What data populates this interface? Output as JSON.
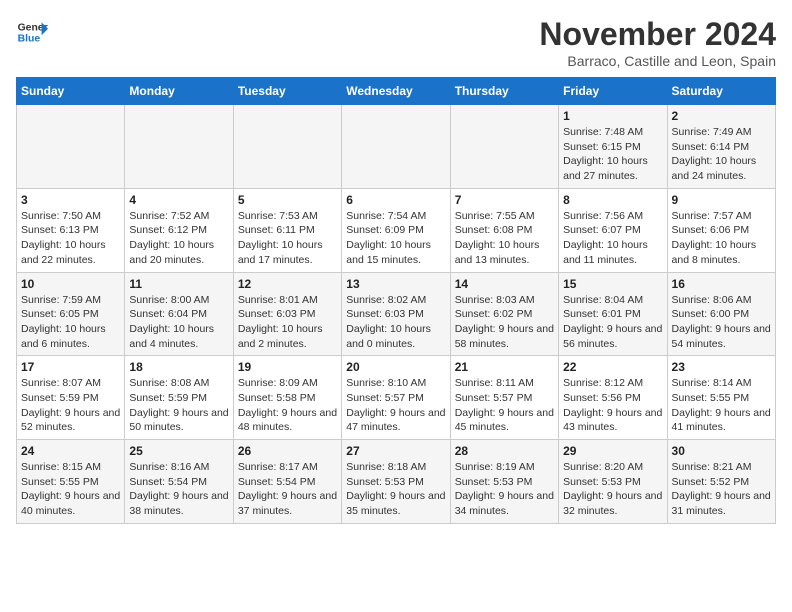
{
  "logo": {
    "line1": "General",
    "line2": "Blue"
  },
  "title": "November 2024",
  "location": "Barraco, Castille and Leon, Spain",
  "days_of_week": [
    "Sunday",
    "Monday",
    "Tuesday",
    "Wednesday",
    "Thursday",
    "Friday",
    "Saturday"
  ],
  "weeks": [
    [
      {
        "day": "",
        "info": ""
      },
      {
        "day": "",
        "info": ""
      },
      {
        "day": "",
        "info": ""
      },
      {
        "day": "",
        "info": ""
      },
      {
        "day": "",
        "info": ""
      },
      {
        "day": "1",
        "info": "Sunrise: 7:48 AM\nSunset: 6:15 PM\nDaylight: 10 hours and 27 minutes."
      },
      {
        "day": "2",
        "info": "Sunrise: 7:49 AM\nSunset: 6:14 PM\nDaylight: 10 hours and 24 minutes."
      }
    ],
    [
      {
        "day": "3",
        "info": "Sunrise: 7:50 AM\nSunset: 6:13 PM\nDaylight: 10 hours and 22 minutes."
      },
      {
        "day": "4",
        "info": "Sunrise: 7:52 AM\nSunset: 6:12 PM\nDaylight: 10 hours and 20 minutes."
      },
      {
        "day": "5",
        "info": "Sunrise: 7:53 AM\nSunset: 6:11 PM\nDaylight: 10 hours and 17 minutes."
      },
      {
        "day": "6",
        "info": "Sunrise: 7:54 AM\nSunset: 6:09 PM\nDaylight: 10 hours and 15 minutes."
      },
      {
        "day": "7",
        "info": "Sunrise: 7:55 AM\nSunset: 6:08 PM\nDaylight: 10 hours and 13 minutes."
      },
      {
        "day": "8",
        "info": "Sunrise: 7:56 AM\nSunset: 6:07 PM\nDaylight: 10 hours and 11 minutes."
      },
      {
        "day": "9",
        "info": "Sunrise: 7:57 AM\nSunset: 6:06 PM\nDaylight: 10 hours and 8 minutes."
      }
    ],
    [
      {
        "day": "10",
        "info": "Sunrise: 7:59 AM\nSunset: 6:05 PM\nDaylight: 10 hours and 6 minutes."
      },
      {
        "day": "11",
        "info": "Sunrise: 8:00 AM\nSunset: 6:04 PM\nDaylight: 10 hours and 4 minutes."
      },
      {
        "day": "12",
        "info": "Sunrise: 8:01 AM\nSunset: 6:03 PM\nDaylight: 10 hours and 2 minutes."
      },
      {
        "day": "13",
        "info": "Sunrise: 8:02 AM\nSunset: 6:03 PM\nDaylight: 10 hours and 0 minutes."
      },
      {
        "day": "14",
        "info": "Sunrise: 8:03 AM\nSunset: 6:02 PM\nDaylight: 9 hours and 58 minutes."
      },
      {
        "day": "15",
        "info": "Sunrise: 8:04 AM\nSunset: 6:01 PM\nDaylight: 9 hours and 56 minutes."
      },
      {
        "day": "16",
        "info": "Sunrise: 8:06 AM\nSunset: 6:00 PM\nDaylight: 9 hours and 54 minutes."
      }
    ],
    [
      {
        "day": "17",
        "info": "Sunrise: 8:07 AM\nSunset: 5:59 PM\nDaylight: 9 hours and 52 minutes."
      },
      {
        "day": "18",
        "info": "Sunrise: 8:08 AM\nSunset: 5:59 PM\nDaylight: 9 hours and 50 minutes."
      },
      {
        "day": "19",
        "info": "Sunrise: 8:09 AM\nSunset: 5:58 PM\nDaylight: 9 hours and 48 minutes."
      },
      {
        "day": "20",
        "info": "Sunrise: 8:10 AM\nSunset: 5:57 PM\nDaylight: 9 hours and 47 minutes."
      },
      {
        "day": "21",
        "info": "Sunrise: 8:11 AM\nSunset: 5:57 PM\nDaylight: 9 hours and 45 minutes."
      },
      {
        "day": "22",
        "info": "Sunrise: 8:12 AM\nSunset: 5:56 PM\nDaylight: 9 hours and 43 minutes."
      },
      {
        "day": "23",
        "info": "Sunrise: 8:14 AM\nSunset: 5:55 PM\nDaylight: 9 hours and 41 minutes."
      }
    ],
    [
      {
        "day": "24",
        "info": "Sunrise: 8:15 AM\nSunset: 5:55 PM\nDaylight: 9 hours and 40 minutes."
      },
      {
        "day": "25",
        "info": "Sunrise: 8:16 AM\nSunset: 5:54 PM\nDaylight: 9 hours and 38 minutes."
      },
      {
        "day": "26",
        "info": "Sunrise: 8:17 AM\nSunset: 5:54 PM\nDaylight: 9 hours and 37 minutes."
      },
      {
        "day": "27",
        "info": "Sunrise: 8:18 AM\nSunset: 5:53 PM\nDaylight: 9 hours and 35 minutes."
      },
      {
        "day": "28",
        "info": "Sunrise: 8:19 AM\nSunset: 5:53 PM\nDaylight: 9 hours and 34 minutes."
      },
      {
        "day": "29",
        "info": "Sunrise: 8:20 AM\nSunset: 5:53 PM\nDaylight: 9 hours and 32 minutes."
      },
      {
        "day": "30",
        "info": "Sunrise: 8:21 AM\nSunset: 5:52 PM\nDaylight: 9 hours and 31 minutes."
      }
    ]
  ]
}
